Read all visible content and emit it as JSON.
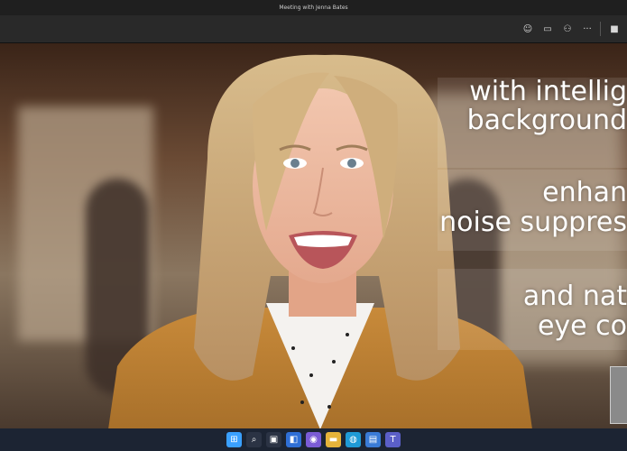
{
  "window": {
    "title": "Meeting with Jenna Bates"
  },
  "toolbar": {
    "buttons": [
      {
        "icon": "reactions-icon",
        "glyph": "☺"
      },
      {
        "icon": "chat-icon",
        "glyph": "▭"
      },
      {
        "icon": "participants-icon",
        "glyph": "⚇"
      },
      {
        "icon": "more-icon",
        "glyph": "···"
      },
      {
        "icon": "camera-icon",
        "glyph": "■"
      }
    ]
  },
  "captions": {
    "line1a": "with intellig",
    "line1b": "background",
    "line2a": "enhan",
    "line2b": "noise suppres",
    "line3a": "and nat",
    "line3b": "eye co"
  },
  "taskbar": {
    "items": [
      {
        "icon": "start-icon",
        "glyph": "⊞",
        "color": "#3aa0ff"
      },
      {
        "icon": "search-icon",
        "glyph": "⌕",
        "color": "#2b3344"
      },
      {
        "icon": "task-view-icon",
        "glyph": "▣",
        "color": "#2b3344"
      },
      {
        "icon": "widgets-icon",
        "glyph": "◧",
        "color": "#2f6fd6"
      },
      {
        "icon": "chat-app-icon",
        "glyph": "◉",
        "color": "#7b5cd6"
      },
      {
        "icon": "file-explorer-icon",
        "glyph": "▬",
        "color": "#e6b33a"
      },
      {
        "icon": "edge-icon",
        "glyph": "◍",
        "color": "#1f9ad6"
      },
      {
        "icon": "store-icon",
        "glyph": "▤",
        "color": "#3a7bd6"
      },
      {
        "icon": "teams-icon",
        "glyph": "T",
        "color": "#5b5fc7"
      }
    ]
  }
}
